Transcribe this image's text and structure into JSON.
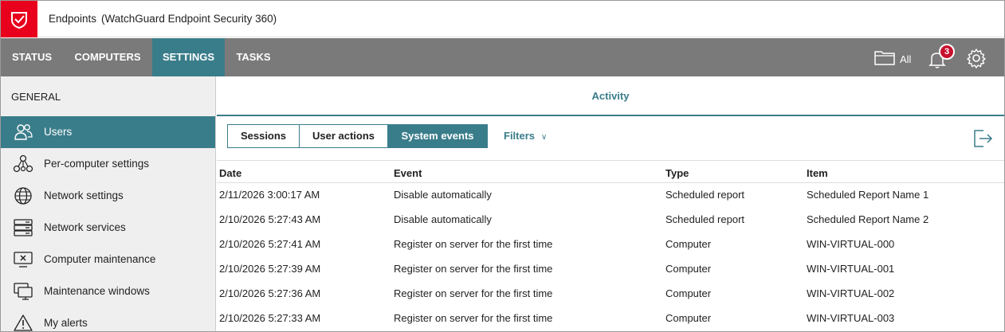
{
  "app": {
    "title": "Endpoints",
    "subtitle": "(WatchGuard Endpoint Security 360)",
    "brand_color": "#e8001c",
    "accent_color": "#3a7d8a"
  },
  "nav": {
    "tabs": [
      {
        "label": "STATUS",
        "active": false
      },
      {
        "label": "COMPUTERS",
        "active": false
      },
      {
        "label": "SETTINGS",
        "active": true
      },
      {
        "label": "TASKS",
        "active": false
      }
    ],
    "folder_label": "All",
    "notification_count": "3"
  },
  "sidebar": {
    "heading": "GENERAL",
    "items": [
      {
        "label": "Users",
        "icon": "users-icon",
        "active": true
      },
      {
        "label": "Per-computer settings",
        "icon": "network-nodes-icon",
        "active": false
      },
      {
        "label": "Network settings",
        "icon": "globe-icon",
        "active": false
      },
      {
        "label": "Network services",
        "icon": "server-icon",
        "active": false
      },
      {
        "label": "Computer maintenance",
        "icon": "monitor-x-icon",
        "active": false
      },
      {
        "label": "Maintenance windows",
        "icon": "monitors-icon",
        "active": false
      },
      {
        "label": "My alerts",
        "icon": "warning-icon",
        "active": false
      }
    ]
  },
  "main": {
    "title": "Activity",
    "segments": [
      {
        "label": "Sessions",
        "active": false
      },
      {
        "label": "User actions",
        "active": false
      },
      {
        "label": "System events",
        "active": true
      }
    ],
    "filters_label": "Filters",
    "table": {
      "columns": [
        "Date",
        "Event",
        "Type",
        "Item"
      ],
      "rows": [
        [
          "2/11/2026 3:00:17 AM",
          "Disable automatically",
          "Scheduled report",
          "Scheduled Report Name 1"
        ],
        [
          "2/10/2026 5:27:43 AM",
          "Disable automatically",
          "Scheduled report",
          "Scheduled Report Name 2"
        ],
        [
          "2/10/2026 5:27:41 AM",
          "Register on server for the first time",
          "Computer",
          "WIN-VIRTUAL-000"
        ],
        [
          "2/10/2026 5:27:39 AM",
          "Register on server for the first time",
          "Computer",
          "WIN-VIRTUAL-001"
        ],
        [
          "2/10/2026 5:27:36 AM",
          "Register on server for the first time",
          "Computer",
          "WIN-VIRTUAL-002"
        ],
        [
          "2/10/2026 5:27:33 AM",
          "Register on server for the first time",
          "Computer",
          "WIN-VIRTUAL-003"
        ]
      ]
    }
  }
}
